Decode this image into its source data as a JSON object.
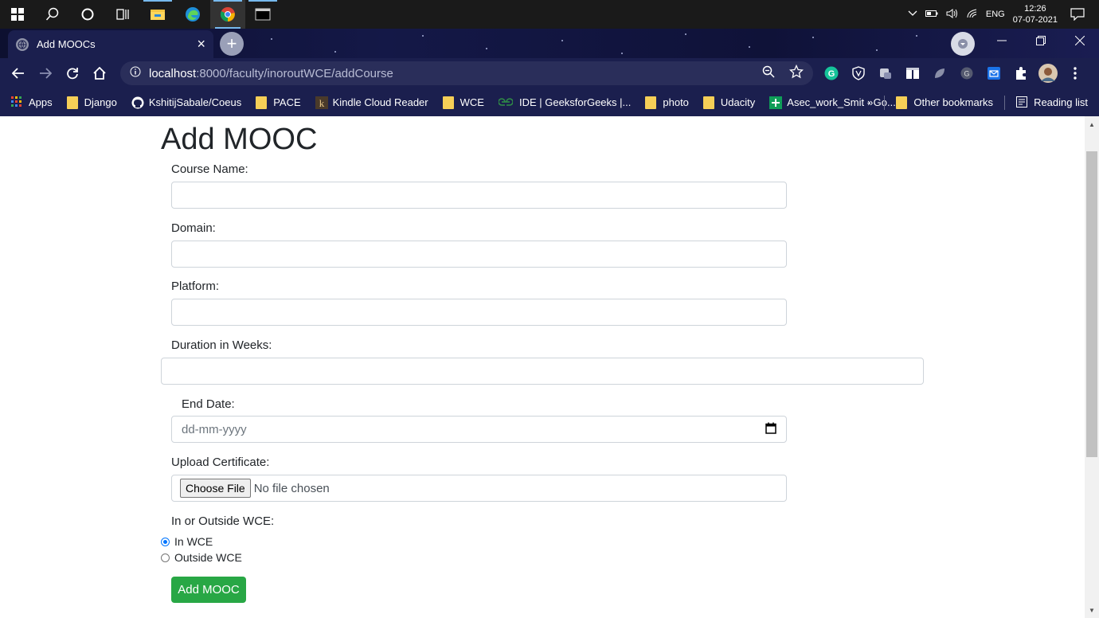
{
  "taskbar": {
    "tray_language": "ENG",
    "time": "12:26",
    "date": "07-07-2021"
  },
  "browser": {
    "tab_title": "Add MOOCs",
    "url_host": "localhost",
    "url_rest": ":8000/faculty/inoroutWCE/addCourse",
    "bookmarks": [
      {
        "label": "Apps",
        "icon": "apps-grid-icon"
      },
      {
        "label": "Django",
        "icon": "folder-icon"
      },
      {
        "label": "KshitijSabale/Coeus",
        "icon": "github-icon"
      },
      {
        "label": "PACE",
        "icon": "folder-icon"
      },
      {
        "label": "Kindle Cloud Reader",
        "icon": "kindle-icon"
      },
      {
        "label": "WCE",
        "icon": "folder-icon"
      },
      {
        "label": "IDE | GeeksforGeeks |...",
        "icon": "geeksforgeeks-icon"
      },
      {
        "label": "photo",
        "icon": "folder-icon"
      },
      {
        "label": "Udacity",
        "icon": "folder-icon"
      },
      {
        "label": "Asec_work_Smit - Go...",
        "icon": "sheets-icon"
      }
    ],
    "overflow_label": "»",
    "other_bookmarks": "Other bookmarks",
    "reading_list": "Reading list"
  },
  "page": {
    "title": "Add MOOC",
    "course_name_label": "Course Name:",
    "domain_label": "Domain:",
    "platform_label": "Platform:",
    "duration_label": "Duration in Weeks:",
    "end_date_label": "End Date:",
    "end_date_placeholder": "dd-mm-yyyy",
    "certificate_label": "Upload Certificate:",
    "choose_file": "Choose File",
    "no_file": "No file chosen",
    "location_label": "In or Outside WCE:",
    "option_in": "In WCE",
    "option_out": "Outside WCE",
    "selected_option": "In WCE",
    "submit_label": "Add MOOC"
  },
  "colors": {
    "submit": "#28a745",
    "radio": "#0075ff",
    "chrome_theme": "#1b1f4e"
  }
}
